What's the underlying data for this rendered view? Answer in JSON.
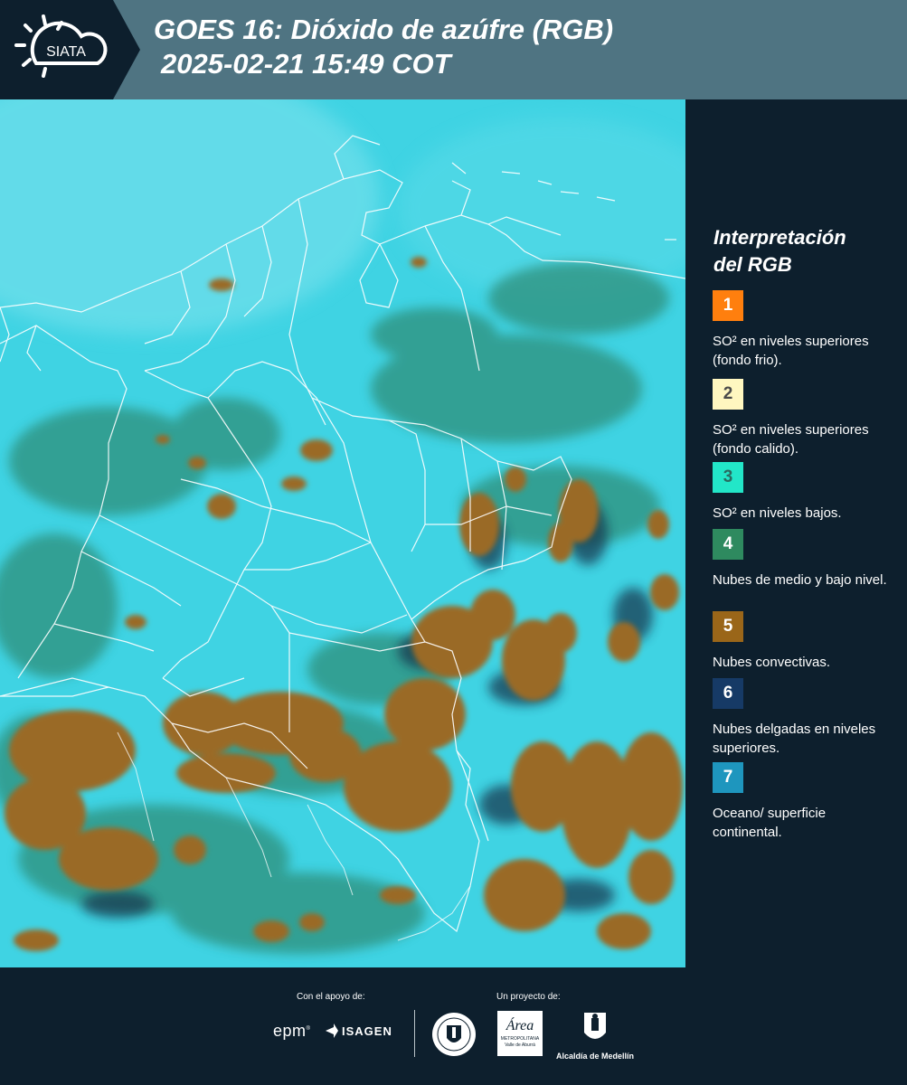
{
  "header": {
    "logo_text": "SIATA",
    "title_line1": "GOES 16: Dióxido de azúfre (RGB)",
    "title_line2": "2025-02-21 15:49 COT"
  },
  "legend": {
    "title_line1": "Interpretación",
    "title_line2": "del RGB",
    "items": [
      {
        "number": "1",
        "color": "#ff7f0e",
        "label": "SO² en niveles superiores (fondo frio)."
      },
      {
        "number": "2",
        "color": "#fff7c0",
        "label": "SO² en niveles superiores (fondo calido)."
      },
      {
        "number": "3",
        "color": "#22e6c8",
        "label": "SO² en niveles bajos."
      },
      {
        "number": "4",
        "color": "#2e8a5f",
        "label": "Nubes de medio y bajo nivel."
      },
      {
        "number": "5",
        "color": "#9a6619",
        "label": "Nubes convectivas."
      },
      {
        "number": "6",
        "color": "#163a66",
        "label": "Nubes delgadas en niveles superiores."
      },
      {
        "number": "7",
        "color": "#1e96be",
        "label": "Oceano/ superficie continental."
      }
    ]
  },
  "footer": {
    "support_label": "Con el apoyo de:",
    "project_label": "Un proyecto de:",
    "sponsor_epm": "epm",
    "sponsor_isagen": "ISAGEN",
    "partner_area_line1": "Área",
    "partner_area_line2": "METROPOLITANA",
    "partner_area_line3": "Valle de Aburrá",
    "partner_alcaldia": "Alcaldía de Medellín"
  },
  "map": {
    "colors": {
      "background": "#3fd3e3",
      "low_clouds": "#2e8f7a",
      "convective": "#9a6a26",
      "thin_high": "#13334a",
      "borders": "#ffffff"
    }
  }
}
